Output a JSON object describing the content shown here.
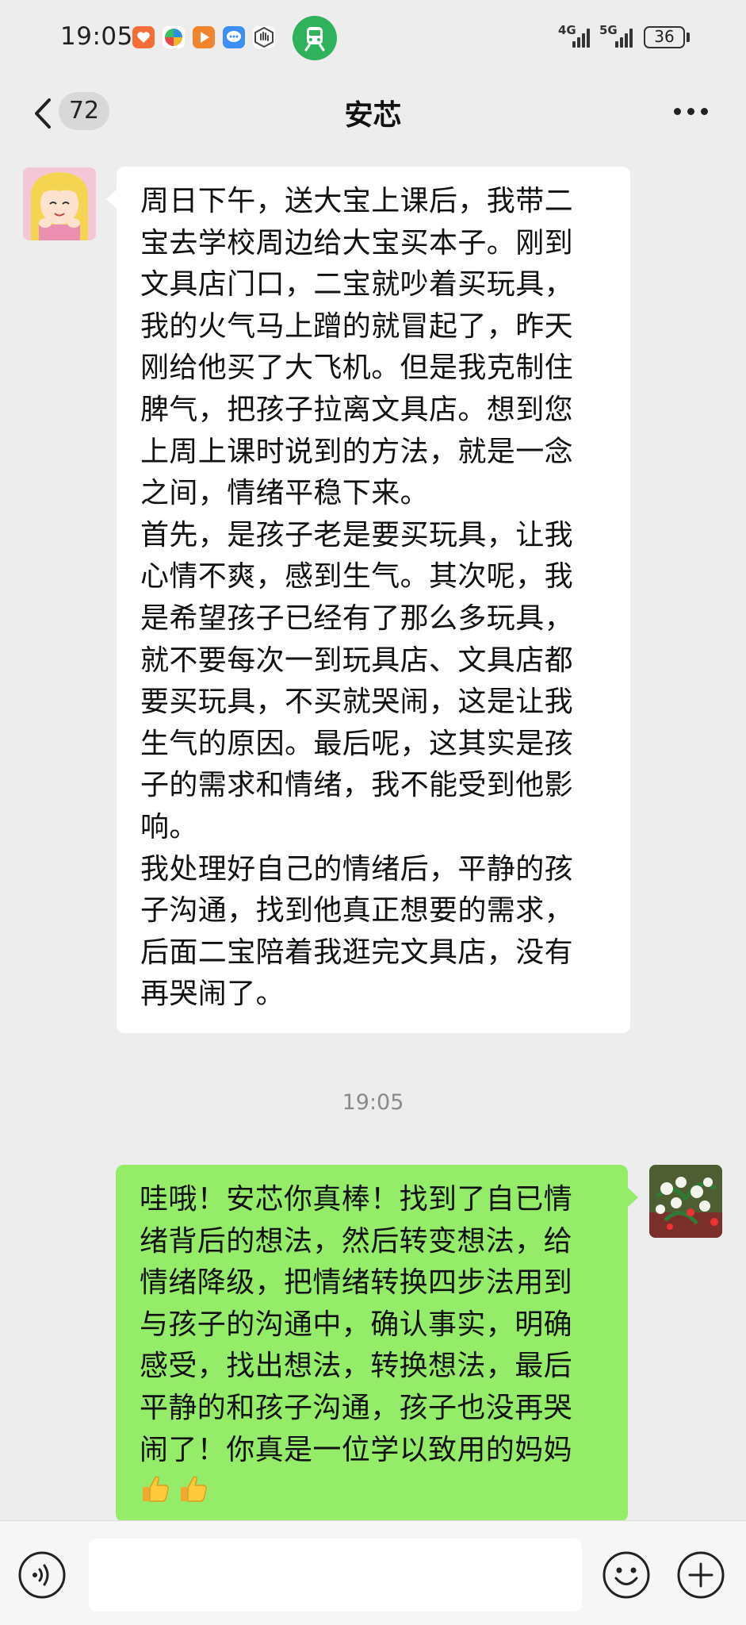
{
  "status_bar": {
    "time": "19:05",
    "app_icons": [
      "heart-shield-icon",
      "pinwheel-icon",
      "video-play-icon",
      "chat-bubble-icon",
      "hand-icon"
    ],
    "active_app_icon": "train-icon",
    "network_1": "4G",
    "network_2": "5G",
    "battery": "36"
  },
  "header": {
    "back_icon": "chevron-left-icon",
    "unread_count": "72",
    "title": "安芯",
    "more_icon": "more-dots-icon"
  },
  "messages": [
    {
      "direction": "incoming",
      "avatar": "cartoon-girl-avatar",
      "lines": [
        "周日下午，送大宝上课后，我带二",
        "宝去学校周边给大宝买本子。刚到",
        "文具店门口，二宝就吵着买玩具，",
        "我的火气马上蹭的就冒起了，昨天",
        "刚给他买了大飞机。但是我克制住",
        "脾气，把孩子拉离文具店。想到您",
        "上周上课时说到的方法，就是一念",
        "之间，情绪平稳下来。",
        "首先，是孩子老是要买玩具，让我",
        "心情不爽，感到生气。其次呢，我",
        "是希望孩子已经有了那么多玩具，",
        "就不要每次一到玩具店、文具店都",
        "要买玩具，不买就哭闹，这是让我",
        "生气的原因。最后呢，这其实是孩",
        "子的需求和情绪，我不能受到他影",
        "响。",
        "我处理好自己的情绪后，平静的孩",
        "子沟通，找到他真正想要的需求，",
        "后面二宝陪着我逛完文具店，没有",
        "再哭闹了。"
      ]
    },
    {
      "direction": "outgoing",
      "avatar": "flowers-avatar",
      "lines": [
        "哇哦！安芯你真棒！找到了自已情",
        "绪背后的想法，然后转变想法，给",
        "情绪降级，把情绪转换四步法用到",
        "与孩子的沟通中，确认事实，明确",
        "感受，找出想法，转换想法，最后",
        "平静的和孩子沟通，孩子也没再哭",
        "闹了！你真是一位学以致用的妈妈"
      ],
      "emojis": [
        "thumbs-up-icon",
        "thumbs-up-icon"
      ]
    }
  ],
  "timestamp": "19:05",
  "input_bar": {
    "voice_icon": "voice-icon",
    "input_value": "",
    "emoji_icon": "emoji-icon",
    "add_icon": "plus-icon"
  },
  "colors": {
    "background": "#ededed",
    "incoming_bubble": "#ffffff",
    "outgoing_bubble": "#95ec69",
    "train_icon": "#2fb25b"
  }
}
